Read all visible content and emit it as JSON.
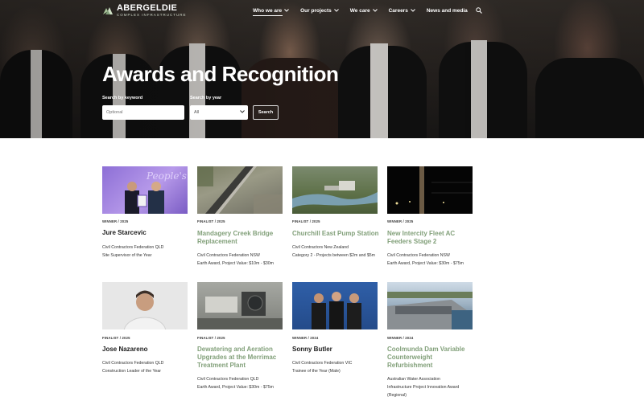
{
  "brand": {
    "name": "ABERGELDIE",
    "tagline": "COMPLEX INFRASTRUCTURE",
    "colors": {
      "accent_green": "#82a07a",
      "logo_green": "#a8c59a"
    }
  },
  "nav": {
    "items": [
      {
        "label": "Who we are",
        "has_dropdown": true,
        "active": true
      },
      {
        "label": "Our projects",
        "has_dropdown": true,
        "active": false
      },
      {
        "label": "We care",
        "has_dropdown": true,
        "active": false
      },
      {
        "label": "Careers",
        "has_dropdown": true,
        "active": false
      },
      {
        "label": "News and media",
        "has_dropdown": false,
        "active": false
      }
    ],
    "search_icon": "search-icon"
  },
  "hero": {
    "title": "Awards and Recognition",
    "keyword_label": "Search by keyword",
    "keyword_placeholder": "Optional",
    "year_label": "Search by year",
    "year_value": "All",
    "search_button": "Search"
  },
  "awards": [
    {
      "status": "WINNER / 2025",
      "title": "Jure Starcevic",
      "title_style": "dark",
      "lines": [
        "Civil Contractors Federation QLD",
        "Site Supervisor of the Year"
      ]
    },
    {
      "status": "FINALIST / 2025",
      "title": "Mandagery Creek Bridge Replacement",
      "title_style": "green",
      "lines": [
        "Civil Contractors Federation NSW",
        "Earth Award, Project Value: $10m - $30m"
      ]
    },
    {
      "status": "FINALIST / 2025",
      "title": "Churchill East Pump Station",
      "title_style": "green",
      "lines": [
        "Civil Contractors New Zealand",
        "Category 2 - Projects between $2m and $5m"
      ]
    },
    {
      "status": "WINNER / 2025",
      "title": "New Intercity Fleet AC Feeders Stage 2",
      "title_style": "green",
      "lines": [
        "Civil Contractors Federation NSW",
        "Earth Award, Project Value: $30m - $75m"
      ]
    },
    {
      "status": "FINALIST / 2025",
      "title": "Jose Nazareno",
      "title_style": "dark",
      "lines": [
        "Civil Contractors Federation QLD",
        "Construction Leader of the Year"
      ]
    },
    {
      "status": "FINALIST / 2025",
      "title": "Dewatering and Aeration Upgrades at the Merrimac Treatment Plant",
      "title_style": "green",
      "lines": [
        "Civil Contractors Federation QLD",
        "Earth Award, Project Value: $30m - $75m"
      ]
    },
    {
      "status": "WINNER / 2024",
      "title": "Sonny Butler",
      "title_style": "dark",
      "lines": [
        "Civil Contractors Federation VIC",
        "Trainee of the Year (Male)"
      ]
    },
    {
      "status": "WINNER / 2024",
      "title": "Coolmunda Dam Variable Counterweight Refurbishment",
      "title_style": "green",
      "lines": [
        "Australian Water Association",
        "Infrastructure Project Innovation Award (Regional)"
      ]
    }
  ]
}
